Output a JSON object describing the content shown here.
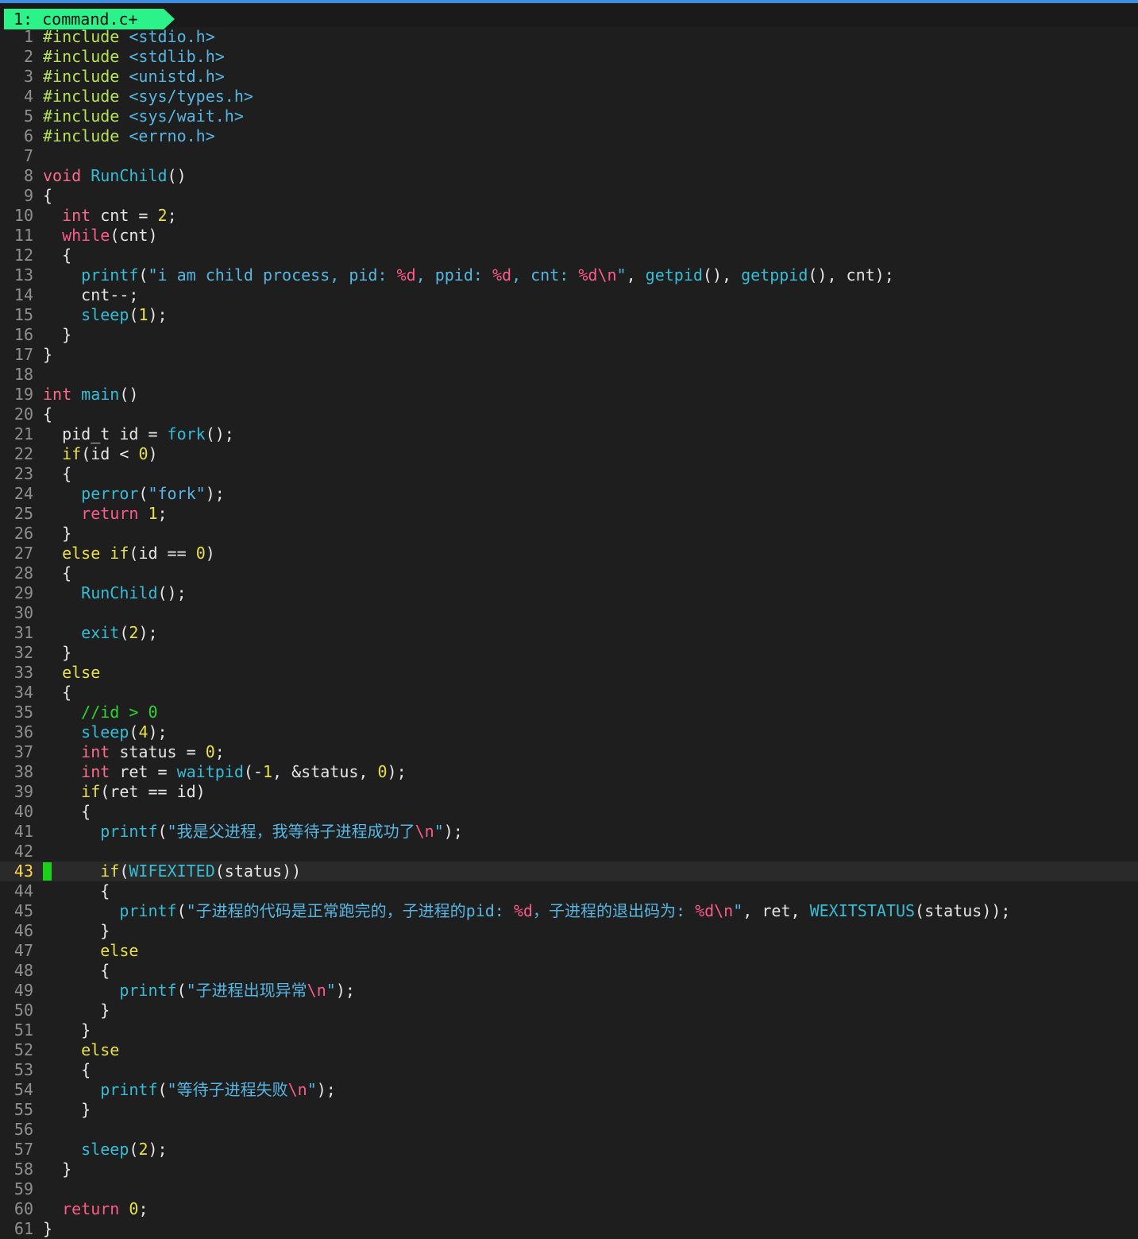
{
  "window": {
    "tab_label": "1: command.c+",
    "colors": {
      "tab_bg": "#2cf28a",
      "background": "#1e1e1e",
      "cursor": "#19d219",
      "accent_line": "#3f8de0"
    }
  },
  "editor": {
    "current_line": 43,
    "lines": [
      {
        "n": "1",
        "tokens": [
          [
            "pre",
            "#include "
          ],
          [
            "hdr",
            "<stdio.h>"
          ]
        ]
      },
      {
        "n": "2",
        "tokens": [
          [
            "pre",
            "#include "
          ],
          [
            "hdr",
            "<stdlib.h>"
          ]
        ]
      },
      {
        "n": "3",
        "tokens": [
          [
            "pre",
            "#include "
          ],
          [
            "hdr",
            "<unistd.h>"
          ]
        ]
      },
      {
        "n": "4",
        "tokens": [
          [
            "pre",
            "#include "
          ],
          [
            "hdr",
            "<sys/types.h>"
          ]
        ]
      },
      {
        "n": "5",
        "tokens": [
          [
            "pre",
            "#include "
          ],
          [
            "hdr",
            "<sys/wait.h>"
          ]
        ]
      },
      {
        "n": "6",
        "tokens": [
          [
            "pre",
            "#include "
          ],
          [
            "hdr",
            "<errno.h>"
          ]
        ]
      },
      {
        "n": "7",
        "tokens": []
      },
      {
        "n": "8",
        "tokens": [
          [
            "typ",
            "void"
          ],
          [
            "ident",
            " "
          ],
          [
            "fn",
            "RunChild"
          ],
          [
            "ident",
            "()"
          ]
        ]
      },
      {
        "n": "9",
        "tokens": [
          [
            "ident",
            "{"
          ]
        ]
      },
      {
        "n": "10",
        "tokens": [
          [
            "ident",
            "  "
          ],
          [
            "typ",
            "int"
          ],
          [
            "ident",
            " cnt = "
          ],
          [
            "num",
            "2"
          ],
          [
            "ident",
            ";"
          ]
        ]
      },
      {
        "n": "11",
        "tokens": [
          [
            "ident",
            "  "
          ],
          [
            "kw",
            "while"
          ],
          [
            "ident",
            "(cnt)"
          ]
        ]
      },
      {
        "n": "12",
        "tokens": [
          [
            "ident",
            "  {"
          ]
        ]
      },
      {
        "n": "13",
        "tokens": [
          [
            "ident",
            "    "
          ],
          [
            "fn",
            "printf"
          ],
          [
            "ident",
            "("
          ],
          [
            "str",
            "\"i am child process, pid: "
          ],
          [
            "fmt",
            "%d"
          ],
          [
            "str",
            ", ppid: "
          ],
          [
            "fmt",
            "%d"
          ],
          [
            "str",
            ", cnt: "
          ],
          [
            "fmt",
            "%d\\n"
          ],
          [
            "str",
            "\""
          ],
          [
            "ident",
            ", "
          ],
          [
            "fn",
            "getpid"
          ],
          [
            "ident",
            "(), "
          ],
          [
            "fn",
            "getppid"
          ],
          [
            "ident",
            "(), cnt);"
          ]
        ]
      },
      {
        "n": "14",
        "tokens": [
          [
            "ident",
            "    cnt--;"
          ]
        ]
      },
      {
        "n": "15",
        "tokens": [
          [
            "ident",
            "    "
          ],
          [
            "fn",
            "sleep"
          ],
          [
            "ident",
            "("
          ],
          [
            "num",
            "1"
          ],
          [
            "ident",
            ");"
          ]
        ]
      },
      {
        "n": "16",
        "tokens": [
          [
            "ident",
            "  }"
          ]
        ]
      },
      {
        "n": "17",
        "tokens": [
          [
            "ident",
            "}"
          ]
        ]
      },
      {
        "n": "18",
        "tokens": []
      },
      {
        "n": "19",
        "tokens": [
          [
            "typ",
            "int"
          ],
          [
            "ident",
            " "
          ],
          [
            "fn",
            "main"
          ],
          [
            "ident",
            "()"
          ]
        ]
      },
      {
        "n": "20",
        "tokens": [
          [
            "ident",
            "{"
          ]
        ]
      },
      {
        "n": "21",
        "tokens": [
          [
            "ident",
            "  pid_t id = "
          ],
          [
            "fn",
            "fork"
          ],
          [
            "ident",
            "();"
          ]
        ]
      },
      {
        "n": "22",
        "tokens": [
          [
            "ident",
            "  "
          ],
          [
            "ctl",
            "if"
          ],
          [
            "ident",
            "(id < "
          ],
          [
            "num",
            "0"
          ],
          [
            "ident",
            ")"
          ]
        ]
      },
      {
        "n": "23",
        "tokens": [
          [
            "ident",
            "  {"
          ]
        ]
      },
      {
        "n": "24",
        "tokens": [
          [
            "ident",
            "    "
          ],
          [
            "fn",
            "perror"
          ],
          [
            "ident",
            "("
          ],
          [
            "str",
            "\"fork\""
          ],
          [
            "ident",
            ");"
          ]
        ]
      },
      {
        "n": "25",
        "tokens": [
          [
            "ident",
            "    "
          ],
          [
            "kw",
            "return"
          ],
          [
            "ident",
            " "
          ],
          [
            "num",
            "1"
          ],
          [
            "ident",
            ";"
          ]
        ]
      },
      {
        "n": "26",
        "tokens": [
          [
            "ident",
            "  }"
          ]
        ]
      },
      {
        "n": "27",
        "tokens": [
          [
            "ident",
            "  "
          ],
          [
            "ctl",
            "else if"
          ],
          [
            "ident",
            "(id == "
          ],
          [
            "num",
            "0"
          ],
          [
            "ident",
            ")"
          ]
        ]
      },
      {
        "n": "28",
        "tokens": [
          [
            "ident",
            "  {"
          ]
        ]
      },
      {
        "n": "29",
        "tokens": [
          [
            "ident",
            "    "
          ],
          [
            "fn",
            "RunChild"
          ],
          [
            "ident",
            "();"
          ]
        ]
      },
      {
        "n": "30",
        "tokens": []
      },
      {
        "n": "31",
        "tokens": [
          [
            "ident",
            "    "
          ],
          [
            "fn",
            "exit"
          ],
          [
            "ident",
            "("
          ],
          [
            "num",
            "2"
          ],
          [
            "ident",
            ");"
          ]
        ]
      },
      {
        "n": "32",
        "tokens": [
          [
            "ident",
            "  }"
          ]
        ]
      },
      {
        "n": "33",
        "tokens": [
          [
            "ident",
            "  "
          ],
          [
            "ctl",
            "else"
          ]
        ]
      },
      {
        "n": "34",
        "tokens": [
          [
            "ident",
            "  {"
          ]
        ]
      },
      {
        "n": "35",
        "tokens": [
          [
            "ident",
            "    "
          ],
          [
            "com",
            "//id > 0"
          ]
        ]
      },
      {
        "n": "36",
        "tokens": [
          [
            "ident",
            "    "
          ],
          [
            "fn",
            "sleep"
          ],
          [
            "ident",
            "("
          ],
          [
            "num",
            "4"
          ],
          [
            "ident",
            ");"
          ]
        ]
      },
      {
        "n": "37",
        "tokens": [
          [
            "ident",
            "    "
          ],
          [
            "typ",
            "int"
          ],
          [
            "ident",
            " status = "
          ],
          [
            "num",
            "0"
          ],
          [
            "ident",
            ";"
          ]
        ]
      },
      {
        "n": "38",
        "tokens": [
          [
            "ident",
            "    "
          ],
          [
            "typ",
            "int"
          ],
          [
            "ident",
            " ret = "
          ],
          [
            "fn",
            "waitpid"
          ],
          [
            "ident",
            "(-"
          ],
          [
            "num",
            "1"
          ],
          [
            "ident",
            ", &status, "
          ],
          [
            "num",
            "0"
          ],
          [
            "ident",
            ");"
          ]
        ]
      },
      {
        "n": "39",
        "tokens": [
          [
            "ident",
            "    "
          ],
          [
            "ctl",
            "if"
          ],
          [
            "ident",
            "(ret == id)"
          ]
        ]
      },
      {
        "n": "40",
        "tokens": [
          [
            "ident",
            "    {"
          ]
        ]
      },
      {
        "n": "41",
        "tokens": [
          [
            "ident",
            "      "
          ],
          [
            "fn",
            "printf"
          ],
          [
            "ident",
            "("
          ],
          [
            "str",
            "\"我是父进程，我等待子进程成功了"
          ],
          [
            "fmt",
            "\\n"
          ],
          [
            "str",
            "\""
          ],
          [
            "ident",
            ");"
          ]
        ]
      },
      {
        "n": "42",
        "tokens": []
      },
      {
        "n": "43",
        "tokens": [
          [
            "ident",
            "      "
          ],
          [
            "ctl",
            "if"
          ],
          [
            "ident",
            "("
          ],
          [
            "fn",
            "WIFEXITED"
          ],
          [
            "ident",
            "(status))"
          ]
        ]
      },
      {
        "n": "44",
        "tokens": [
          [
            "ident",
            "      {"
          ]
        ]
      },
      {
        "n": "45",
        "tokens": [
          [
            "ident",
            "        "
          ],
          [
            "fn",
            "printf"
          ],
          [
            "ident",
            "("
          ],
          [
            "str",
            "\"子进程的代码是正常跑完的，子进程的pid: "
          ],
          [
            "fmt",
            "%d"
          ],
          [
            "str",
            "，子进程的退出码为: "
          ],
          [
            "fmt",
            "%d\\n"
          ],
          [
            "str",
            "\""
          ],
          [
            "ident",
            ", ret, "
          ],
          [
            "fn",
            "WEXITSTATUS"
          ],
          [
            "ident",
            "(status));"
          ]
        ]
      },
      {
        "n": "46",
        "tokens": [
          [
            "ident",
            "      }"
          ]
        ]
      },
      {
        "n": "47",
        "tokens": [
          [
            "ident",
            "      "
          ],
          [
            "ctl",
            "else"
          ]
        ]
      },
      {
        "n": "48",
        "tokens": [
          [
            "ident",
            "      {"
          ]
        ]
      },
      {
        "n": "49",
        "tokens": [
          [
            "ident",
            "        "
          ],
          [
            "fn",
            "printf"
          ],
          [
            "ident",
            "("
          ],
          [
            "str",
            "\"子进程出现异常"
          ],
          [
            "fmt",
            "\\n"
          ],
          [
            "str",
            "\""
          ],
          [
            "ident",
            ");"
          ]
        ]
      },
      {
        "n": "50",
        "tokens": [
          [
            "ident",
            "      }"
          ]
        ]
      },
      {
        "n": "51",
        "tokens": [
          [
            "ident",
            "    }"
          ]
        ]
      },
      {
        "n": "52",
        "tokens": [
          [
            "ident",
            "    "
          ],
          [
            "ctl",
            "else"
          ]
        ]
      },
      {
        "n": "53",
        "tokens": [
          [
            "ident",
            "    {"
          ]
        ]
      },
      {
        "n": "54",
        "tokens": [
          [
            "ident",
            "      "
          ],
          [
            "fn",
            "printf"
          ],
          [
            "ident",
            "("
          ],
          [
            "str",
            "\"等待子进程失败"
          ],
          [
            "fmt",
            "\\n"
          ],
          [
            "str",
            "\""
          ],
          [
            "ident",
            ");"
          ]
        ]
      },
      {
        "n": "55",
        "tokens": [
          [
            "ident",
            "    }"
          ]
        ]
      },
      {
        "n": "56",
        "tokens": []
      },
      {
        "n": "57",
        "tokens": [
          [
            "ident",
            "    "
          ],
          [
            "fn",
            "sleep"
          ],
          [
            "ident",
            "("
          ],
          [
            "num",
            "2"
          ],
          [
            "ident",
            ");"
          ]
        ]
      },
      {
        "n": "58",
        "tokens": [
          [
            "ident",
            "  }"
          ]
        ]
      },
      {
        "n": "59",
        "tokens": []
      },
      {
        "n": "60",
        "tokens": [
          [
            "ident",
            "  "
          ],
          [
            "kw",
            "return"
          ],
          [
            "ident",
            " "
          ],
          [
            "num",
            "0"
          ],
          [
            "ident",
            ";"
          ]
        ]
      },
      {
        "n": "61",
        "tokens": [
          [
            "ident",
            "}"
          ]
        ]
      }
    ]
  }
}
